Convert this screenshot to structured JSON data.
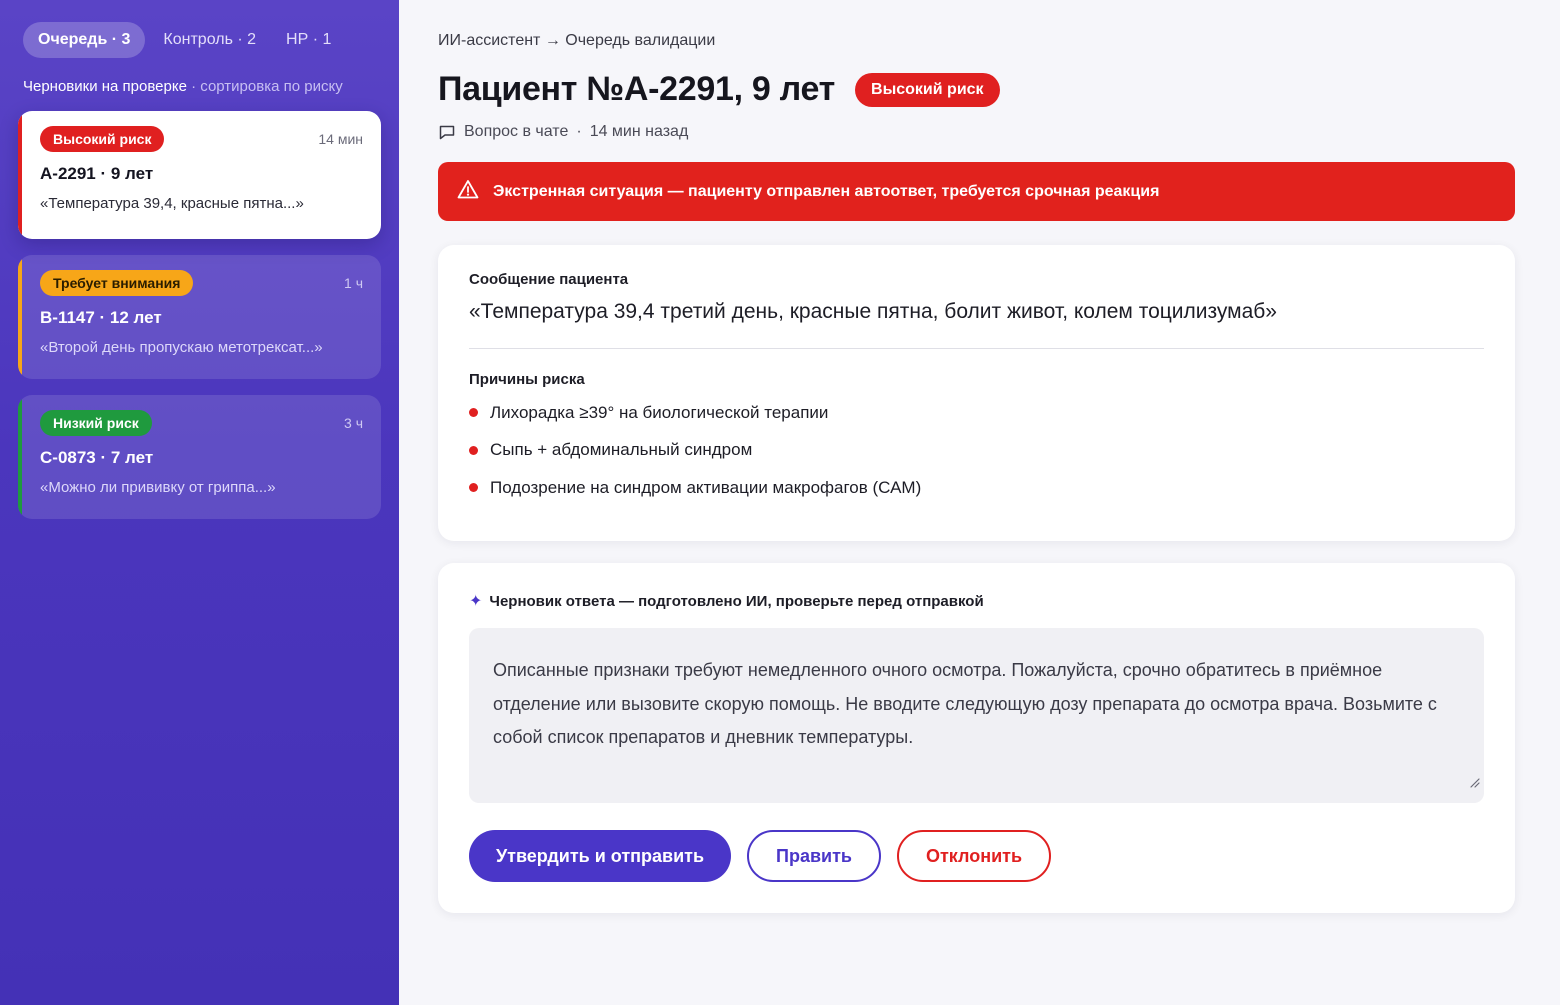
{
  "sidebar": {
    "tabs": [
      {
        "label": "Очередь · 3",
        "active": true
      },
      {
        "label": "Контроль · 2",
        "active": false
      },
      {
        "label": "НР · 1",
        "active": false
      }
    ],
    "subtitle_main": "Черновики на проверке",
    "subtitle_sep": " · ",
    "subtitle_sort": "сортировка по риску",
    "queue": [
      {
        "badge": "Высокий риск",
        "badge_color": "#e02020",
        "time": "14 мин",
        "id": "А-2291 · 9 лет",
        "message": "«Температура 39,4, красные пятна...»",
        "selected": true
      },
      {
        "badge": "Требует внимания",
        "badge_color": "#f7a618",
        "time": "1 ч",
        "id": "В-1147 · 12 лет",
        "message": "«Второй день пропускаю метотрексат...»",
        "selected": false
      },
      {
        "badge": "Низкий риск",
        "badge_color": "#1f9a3e",
        "time": "3 ч",
        "id": "С-0873 · 7 лет",
        "message": "«Можно ли прививку от гриппа...»",
        "selected": false
      }
    ]
  },
  "main": {
    "breadcrumb": "ИИ-ассистент → Очередь валидации",
    "title": "Пациент №А-2291, 9 лет",
    "title_badge": "Высокий риск",
    "meta_source": "Вопрос в чате",
    "meta_sep": "·",
    "meta_time": "14 мин назад",
    "alert": "Экстренная ситуация — пациенту отправлен автоответ, требуется срочная реакция",
    "patient_card": {
      "label": "Сообщение пациента",
      "message": "«Температура 39,4 третий день, красные пятна, болит живот, колем тоцилизумаб»",
      "reasons_label": "Причины риска",
      "reasons": [
        "Лихорадка ≥39° на биологической терапии",
        "Сыпь + абдоминальный синдром",
        "Подозрение на синдром активации макрофагов (САМ)"
      ]
    },
    "draft_card": {
      "label": "Черновик ответа — подготовлено ИИ, проверьте перед отправкой",
      "text": "Описанные признаки требуют немедленного очного осмотра. Пожалуйста, срочно обратитесь в приёмное отделение или вызовите скорую помощь. Не вводите следующую дозу препарата до осмотра врача. Возьмите с собой список препаратов и дневник температуры."
    },
    "actions": {
      "approve": "Утвердить и отправить",
      "edit": "Править",
      "reject": "Отклонить"
    }
  },
  "colors": {
    "accent": "#4a36c8",
    "danger": "#e02020",
    "warning": "#f7a618",
    "success": "#1f9a3e",
    "sidebar_bg": "#4b36bd"
  },
  "icons": {
    "meta": "chat-bubble-icon",
    "alert": "warning-triangle-icon",
    "draft": "sparkle-icon",
    "textarea": "resize-handle-icon"
  }
}
